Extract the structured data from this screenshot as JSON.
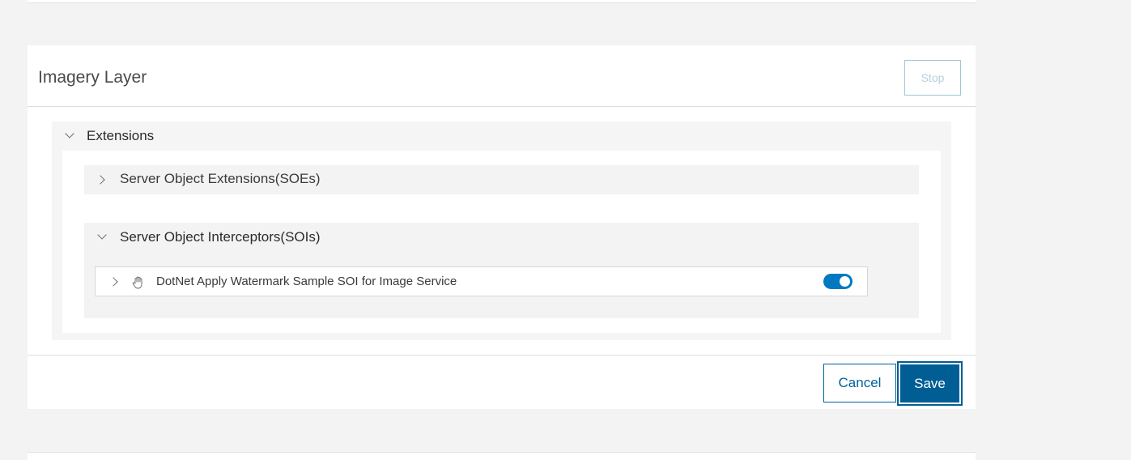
{
  "card": {
    "title": "Imagery Layer",
    "stop_label": "Stop"
  },
  "extensions": {
    "label": "Extensions",
    "soe": {
      "label": "Server Object Extensions(SOEs)"
    },
    "soi": {
      "label": "Server Object Interceptors(SOIs)",
      "items": [
        {
          "label": "DotNet Apply Watermark Sample SOI for Image Service",
          "enabled": true,
          "icon": "hand-icon"
        }
      ]
    }
  },
  "footer": {
    "cancel_label": "Cancel",
    "save_label": "Save"
  },
  "colors": {
    "accent": "#0079c1",
    "save_bg": "#005e95",
    "page_bg": "#f3f3f3"
  }
}
